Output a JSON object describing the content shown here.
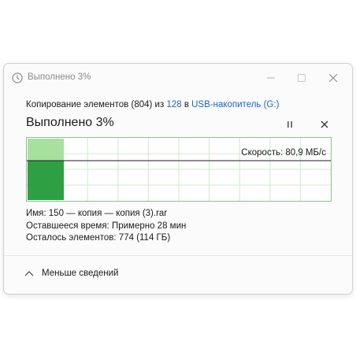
{
  "window": {
    "title": "Выполнено 3%",
    "icons": {
      "app": "clock-icon",
      "minimize": "minimize-icon",
      "maximize": "maximize-icon",
      "close": "close-icon"
    }
  },
  "copy": {
    "prefix": "Копирование элементов (804) из ",
    "from_link": "128",
    "middle": " в ",
    "to_link": "USB-накопитель (G:)",
    "progress_title": "Выполнено 3%",
    "progress_percent": 3,
    "pause_icon": "pause-icon",
    "cancel_icon": "close-icon"
  },
  "graph": {
    "speed_label": "Скорость: 80,9 МБ/с",
    "accent": "#2ea043",
    "light_fill": "#a8e0a0",
    "grid_color": "#cfe8cf",
    "speed_line_level": 0.36
  },
  "details": {
    "name": "Имя:  150 — копия — копия (3).rar",
    "time": "Оставшееся время:  Примерно 28 мин",
    "items": "Осталось элементов:  774 (114 ГБ)"
  },
  "footer": {
    "toggle_label": "Меньше сведений",
    "icon": "chevron-up-icon"
  },
  "colors": {
    "link": "#1f63c8",
    "dim_text": "#8a8a8a"
  }
}
